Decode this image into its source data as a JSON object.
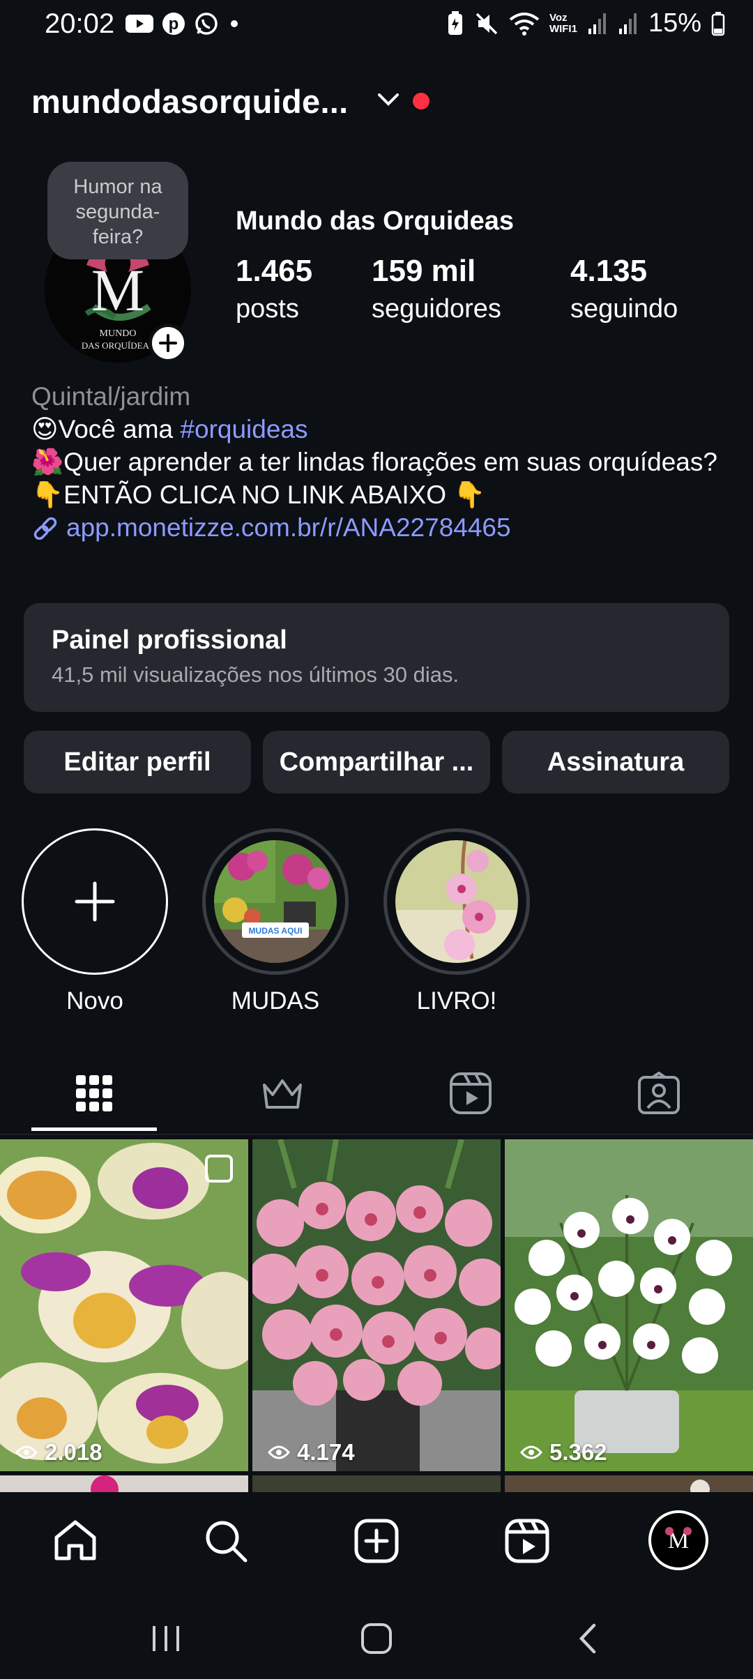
{
  "status_bar": {
    "time": "20:02",
    "left_icons": [
      "youtube-icon",
      "pinterest-icon",
      "whatsapp-icon",
      "dot-icon"
    ],
    "right_icons": [
      "battery-saver-icon",
      "mute-icon",
      "wifi-icon",
      "signal-icon",
      "signal-icon"
    ],
    "wifi_label_top": "Voz",
    "wifi_label_bottom": "WIFI1",
    "battery": "15%"
  },
  "header": {
    "username": "mundodasorquide...",
    "has_notification": true,
    "notification_color": "#ff3040"
  },
  "profile": {
    "note": "Humor na segunda-feira?",
    "display_name": "Mundo das Orquideas",
    "logo_text_line1": "MUNDO",
    "logo_text_line2": "DAS ORQUÍDEAS",
    "stats": [
      {
        "value": "1.465",
        "label": "posts"
      },
      {
        "value": "159 mil",
        "label": "seguidores"
      },
      {
        "value": "4.135",
        "label": "seguindo"
      }
    ]
  },
  "bio": {
    "category": "Quintal/jardim",
    "line1_prefix": "😍Você ama ",
    "line1_hashtag": "#orquideas",
    "line2": "🌺Quer aprender a ter lindas florações em suas orquídeas?",
    "line3": "👇ENTÃO CLICA NO LINK ABAIXO 👇",
    "link": "app.monetizze.com.br/r/ANA22784465",
    "accent_color": "#8c9bff"
  },
  "pro_panel": {
    "title": "Painel profissional",
    "subtitle": "41,5 mil visualizações nos últimos 30 dias."
  },
  "buttons": {
    "edit": "Editar perfil",
    "share": "Compartilhar ...",
    "subscription": "Assinatura"
  },
  "highlights": [
    {
      "label": "Novo"
    },
    {
      "label": "MUDAS",
      "sticker": "MUDAS AQUI"
    },
    {
      "label": "LIVRO!"
    }
  ],
  "tabs": [
    "grid-icon",
    "crown-icon",
    "reels-icon",
    "tagged-icon"
  ],
  "posts": [
    {
      "views": "2.018",
      "multi": true
    },
    {
      "views": "4.174",
      "multi": false
    },
    {
      "views": "5.362",
      "multi": false
    }
  ],
  "bottom_nav": [
    "home-icon",
    "search-icon",
    "create-icon",
    "reels-icon",
    "profile-avatar"
  ],
  "system_nav": [
    "recents-icon",
    "home-icon",
    "back-icon"
  ]
}
